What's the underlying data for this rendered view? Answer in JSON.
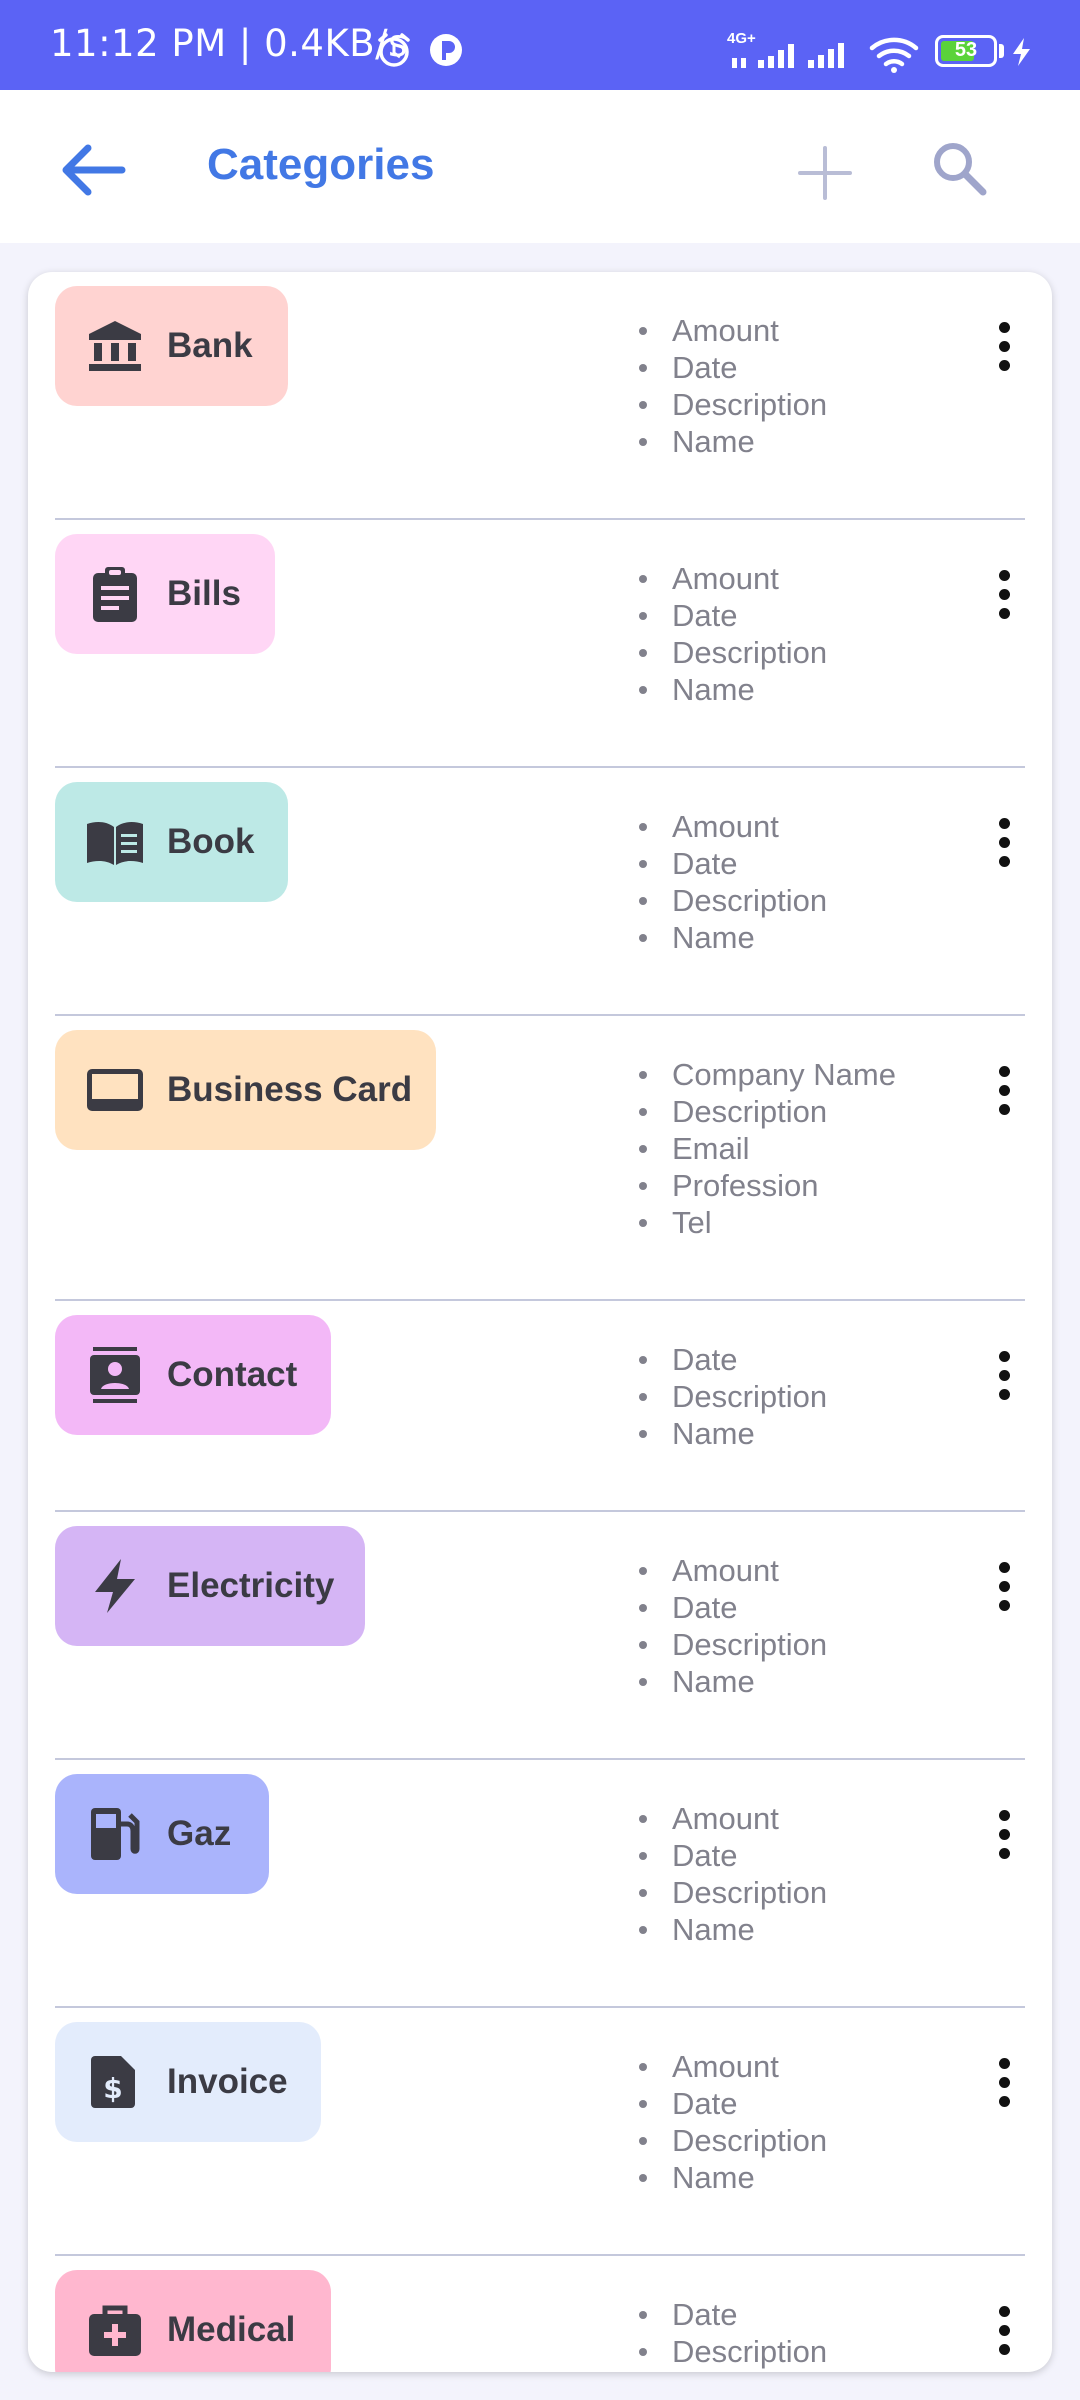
{
  "status_bar": {
    "time_text": "11:12 PM | 0.4KB/s",
    "network_label": "4G+",
    "battery_level": "53",
    "colors": {
      "background": "#5b63f5"
    }
  },
  "app_bar": {
    "title": "Categories",
    "back_icon": "arrow-left-icon",
    "add_icon": "plus-icon",
    "search_icon": "search-icon",
    "title_color": "#4278e5"
  },
  "categories": [
    {
      "name": "Bank",
      "icon": "bank-icon",
      "color": "#ffd3d1",
      "fields": [
        "Amount",
        "Date",
        "Description",
        "Name"
      ]
    },
    {
      "name": "Bills",
      "icon": "clipboard-icon",
      "color": "#ffd6f5",
      "fields": [
        "Amount",
        "Date",
        "Description",
        "Name"
      ]
    },
    {
      "name": "Book",
      "icon": "book-icon",
      "color": "#bde9e6",
      "fields": [
        "Amount",
        "Date",
        "Description",
        "Name"
      ]
    },
    {
      "name": "Business Card",
      "icon": "card-icon",
      "color": "#ffe2c0",
      "fields": [
        "Company Name",
        "Description",
        "Email",
        "Profession",
        "Tel"
      ]
    },
    {
      "name": "Contact",
      "icon": "contact-icon",
      "color": "#f3b8f7",
      "fields": [
        "Date",
        "Description",
        "Name"
      ]
    },
    {
      "name": "Electricity",
      "icon": "bolt-icon",
      "color": "#d5b5f5",
      "fields": [
        "Amount",
        "Date",
        "Description",
        "Name"
      ]
    },
    {
      "name": "Gaz",
      "icon": "gas-station-icon",
      "color": "#aab4fc",
      "fields": [
        "Amount",
        "Date",
        "Description",
        "Name"
      ]
    },
    {
      "name": "Invoice",
      "icon": "invoice-icon",
      "color": "#e3ecfc",
      "fields": [
        "Amount",
        "Date",
        "Description",
        "Name"
      ]
    },
    {
      "name": "Medical",
      "icon": "medical-bag-icon",
      "color": "#ffb7cf",
      "fields": [
        "Date",
        "Description"
      ]
    }
  ]
}
